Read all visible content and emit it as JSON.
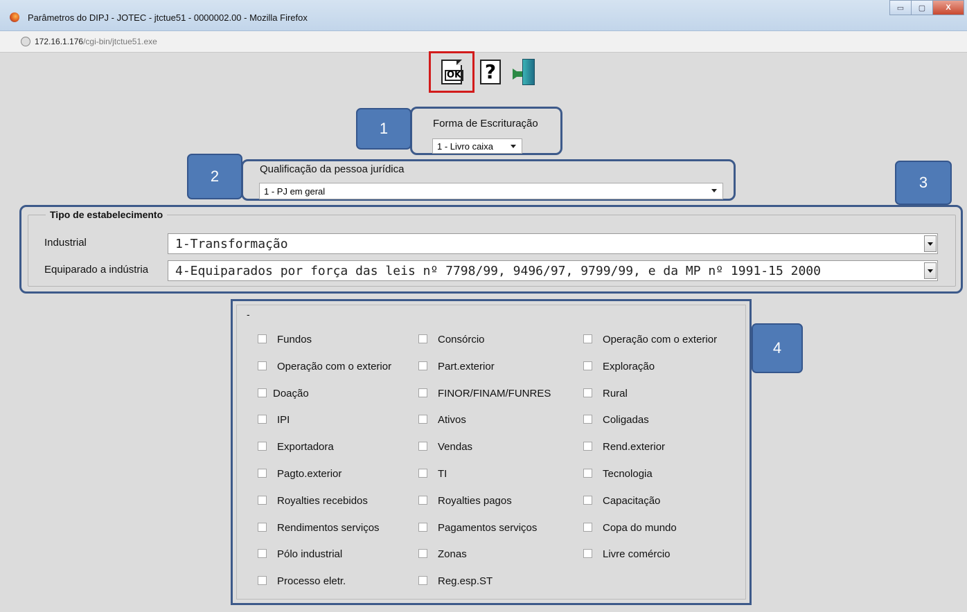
{
  "window": {
    "title": "Parâmetros do DIPJ - JOTEC - jtctue51 - 0000002.00 - Mozilla Firefox",
    "url_host": "172.16.1.176",
    "url_path": "/cgi-bin/jtctue51.exe",
    "controls": {
      "minimize": "▭",
      "maximize": "▢",
      "close": "X"
    }
  },
  "toolbar": {
    "ok_label": "OK",
    "help_label": "?"
  },
  "callouts": {
    "c1": "1",
    "c2": "2",
    "c3": "3",
    "c4": "4"
  },
  "forma": {
    "label": "Forma de Escrituração",
    "value": "1 - Livro caixa"
  },
  "qualificacao": {
    "label": "Qualificação da pessoa jurídica",
    "value": "1 - PJ em geral"
  },
  "tipo_estabelecimento": {
    "legend": "Tipo de estabelecimento",
    "industrial_label": "Industrial",
    "industrial_value": "1-Transformação",
    "equiparado_label": "Equiparado a indústria",
    "equiparado_value": "4-Equiparados por força das leis nº 7798/99, 9496/97, 9799/99, e da MP nº 1991-15 2000"
  },
  "checkbox_panel": {
    "title": "-",
    "col1": [
      "Fundos",
      "Operação com o exterior",
      "Doação",
      "IPI",
      "Exportadora",
      "Pagto.exterior",
      "Royalties recebidos",
      "Rendimentos serviços",
      "Pólo industrial",
      "Processo eletr."
    ],
    "col2": [
      "Consórcio",
      "Part.exterior",
      "FINOR/FINAM/FUNRES",
      "Ativos",
      "Vendas",
      "TI",
      "Royalties pagos",
      "Pagamentos serviços",
      "Zonas",
      "Reg.esp.ST"
    ],
    "col3": [
      "Operação com o exterior",
      "Exploração",
      "Rural",
      "Coligadas",
      "Rend.exterior",
      "Tecnologia",
      "Capacitação",
      "Copa do mundo",
      "Livre comércio"
    ]
  }
}
